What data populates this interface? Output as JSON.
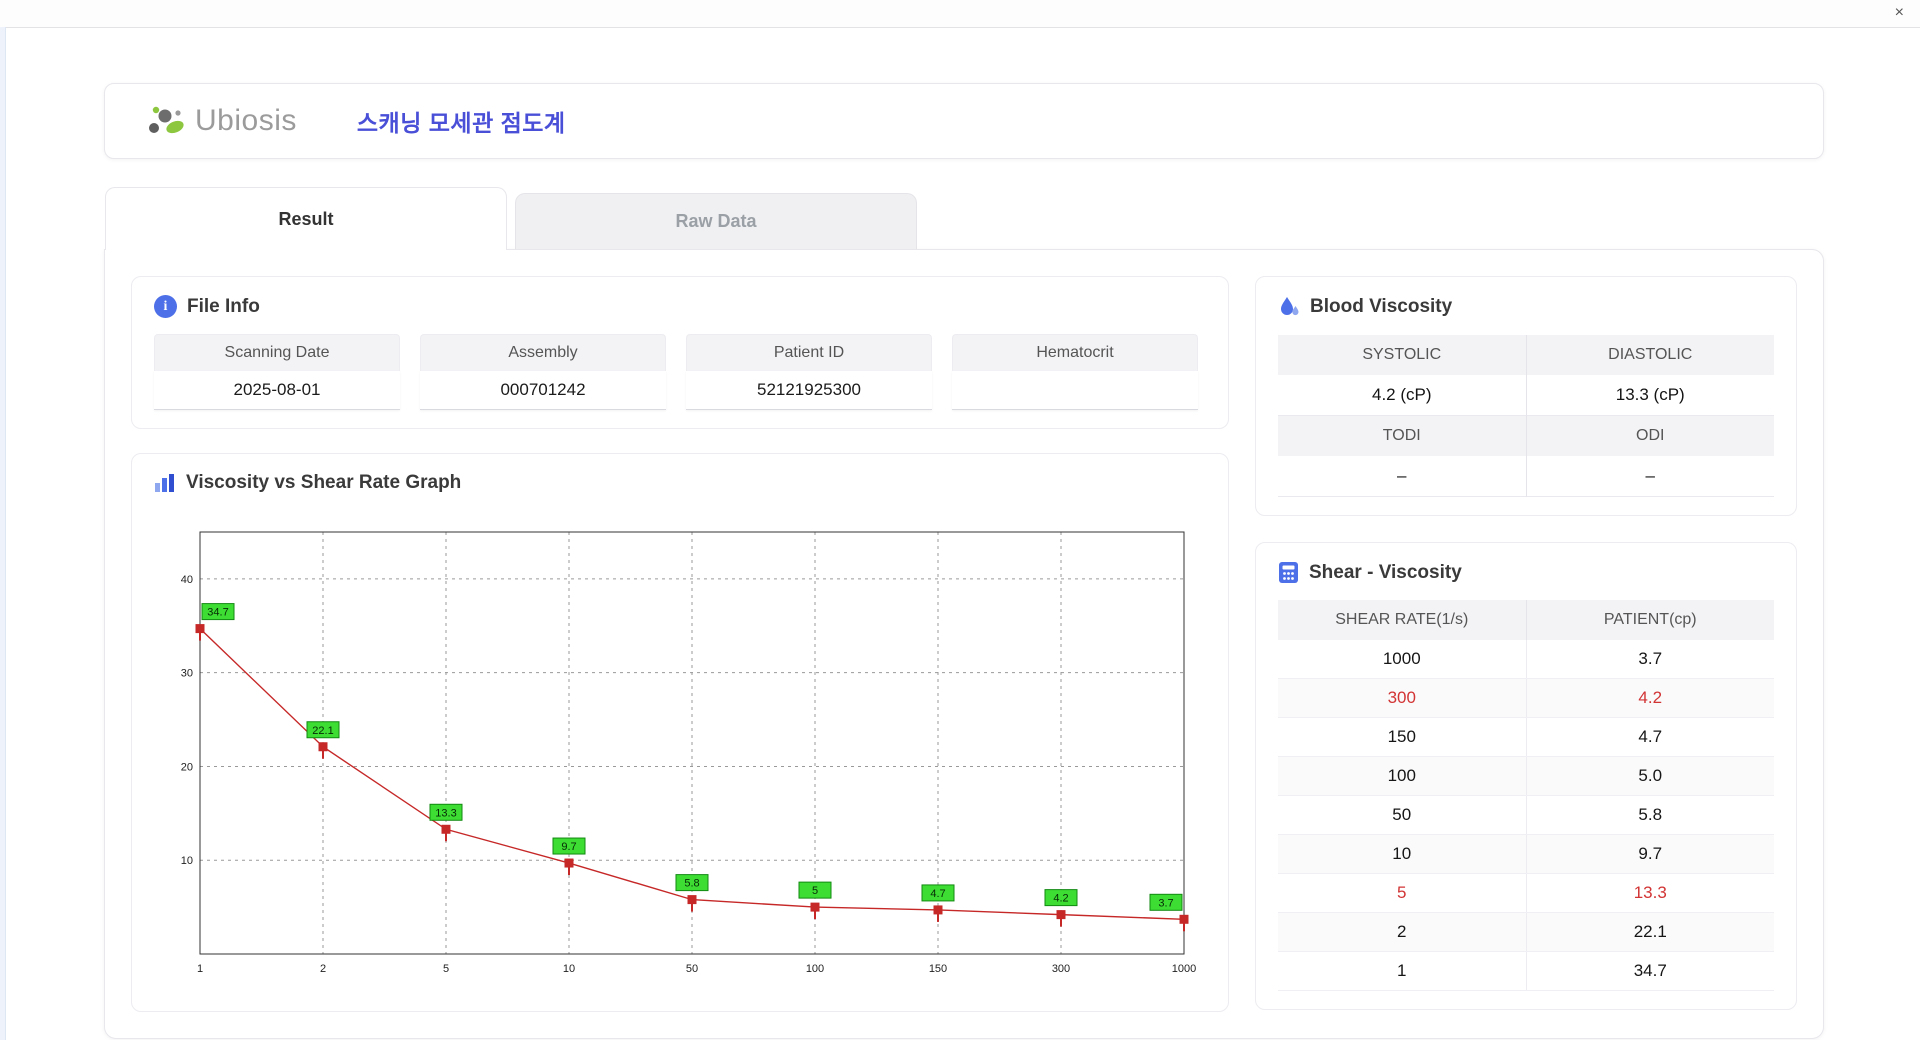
{
  "window": {
    "close_label": "×"
  },
  "header": {
    "logo_text": "Ubiosis",
    "title": "스캐닝 모세관 점도계"
  },
  "tabs": [
    {
      "label": "Result",
      "active": true
    },
    {
      "label": "Raw Data",
      "active": false
    }
  ],
  "file_info": {
    "title": "File Info",
    "fields": [
      {
        "label": "Scanning Date",
        "value": "2025-08-01"
      },
      {
        "label": "Assembly",
        "value": "000701242"
      },
      {
        "label": "Patient ID",
        "value": "52121925300"
      },
      {
        "label": "Hematocrit",
        "value": ""
      }
    ]
  },
  "graph": {
    "title": "Viscosity vs Shear Rate Graph"
  },
  "chart_data": {
    "type": "line",
    "title": "Viscosity vs Shear Rate Graph",
    "x_scale": "categorical",
    "categories": [
      "1",
      "2",
      "5",
      "10",
      "50",
      "100",
      "150",
      "300",
      "1000"
    ],
    "values": [
      34.7,
      22.1,
      13.3,
      9.7,
      5.8,
      5.0,
      4.7,
      4.2,
      3.7
    ],
    "point_labels": [
      "34.7",
      "22.1",
      "13.3",
      "9.7",
      "5.8",
      "5",
      "4.7",
      "4.2",
      "3.7"
    ],
    "xlabel": "",
    "ylabel": "",
    "y_ticks": [
      10,
      20,
      30,
      40
    ],
    "ylim": [
      0,
      45
    ],
    "grid": "dashed",
    "legend": "none",
    "line_color": "#c62828",
    "marker_color": "#c62828",
    "label_bg": "#3ddd33",
    "label_border": "#128a12"
  },
  "blood_viscosity": {
    "title": "Blood Viscosity",
    "rows": [
      {
        "labels": [
          "SYSTOLIC",
          "DIASTOLIC"
        ],
        "values": [
          "4.2 (cP)",
          "13.3 (cP)"
        ]
      },
      {
        "labels": [
          "TODI",
          "ODI"
        ],
        "values": [
          "–",
          "–"
        ]
      }
    ]
  },
  "shear_viscosity": {
    "title": "Shear - Viscosity",
    "columns": [
      "SHEAR RATE(1/s)",
      "PATIENT(cp)"
    ],
    "rows": [
      {
        "rate": "1000",
        "patient": "3.7",
        "highlight": false
      },
      {
        "rate": "300",
        "patient": "4.2",
        "highlight": true
      },
      {
        "rate": "150",
        "patient": "4.7",
        "highlight": false
      },
      {
        "rate": "100",
        "patient": "5.0",
        "highlight": false
      },
      {
        "rate": "50",
        "patient": "5.8",
        "highlight": false
      },
      {
        "rate": "10",
        "patient": "9.7",
        "highlight": false
      },
      {
        "rate": "5",
        "patient": "13.3",
        "highlight": true
      },
      {
        "rate": "2",
        "patient": "22.1",
        "highlight": false
      },
      {
        "rate": "1",
        "patient": "34.7",
        "highlight": false
      }
    ]
  }
}
